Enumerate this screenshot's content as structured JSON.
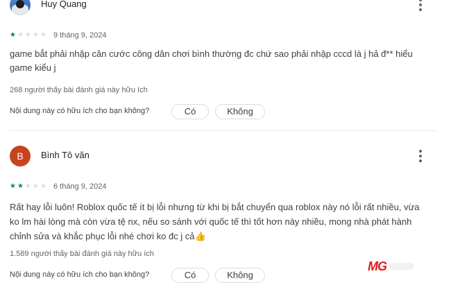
{
  "reviews": [
    {
      "author": "Huy Quang",
      "avatar_type": "image",
      "rating": 1,
      "max_rating": 5,
      "date": "9 tháng 9, 2024",
      "text_lines": [
        "game bắt phải nhập căn cước công dân chơi bình thường đc chứ sao phải nhập cccd là j hả đ** hiểu",
        "game kiểu j"
      ],
      "helpful": "268 người thấy bài đánh giá này hữu ích",
      "question": "Nội dung này có hữu ích cho bạn không?",
      "yes_label": "Có",
      "no_label": "Không"
    },
    {
      "author": "Bình Tô văn",
      "avatar_letter": "B",
      "avatar_color": "#c8431f",
      "rating": 2,
      "max_rating": 5,
      "date": "6 tháng 9, 2024",
      "text_lines": [
        "Rất hay lỗi luôn! Roblox quốc tế ít bị lỗi nhưng từ khi bị bắt chuyển qua roblox này nó lỗi rất nhiều, vừa",
        "ko lm hài lòng mà còn vừa tệ nx, nếu so sánh với quốc tế thì tốt hơn này nhiều, mong nhà phát hành",
        "chỉnh sửa và khắc phục lỗi nhé chơi ko đc j cả👍"
      ],
      "helpful": "1.589 người thấy bài đánh giá này hữu ích",
      "question": "Nội dung này có hữu ích cho bạn không?",
      "yes_label": "Có",
      "no_label": "Không"
    }
  ],
  "star_color": "#01875f",
  "watermark": "MG"
}
